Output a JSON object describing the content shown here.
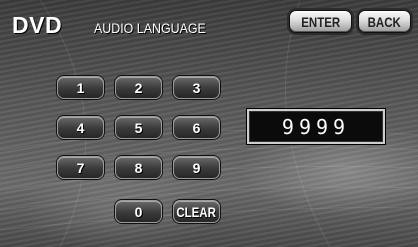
{
  "header": {
    "title": "DVD",
    "subtitle": "AUDIO LANGUAGE"
  },
  "actions": {
    "enter_label": "ENTER",
    "back_label": "BACK"
  },
  "keypad": {
    "key1": "1",
    "key2": "2",
    "key3": "3",
    "key4": "4",
    "key5": "5",
    "key6": "6",
    "key7": "7",
    "key8": "8",
    "key9": "9",
    "key0": "0",
    "clear_label": "CLEAR"
  },
  "entry": {
    "code": "9999"
  }
}
